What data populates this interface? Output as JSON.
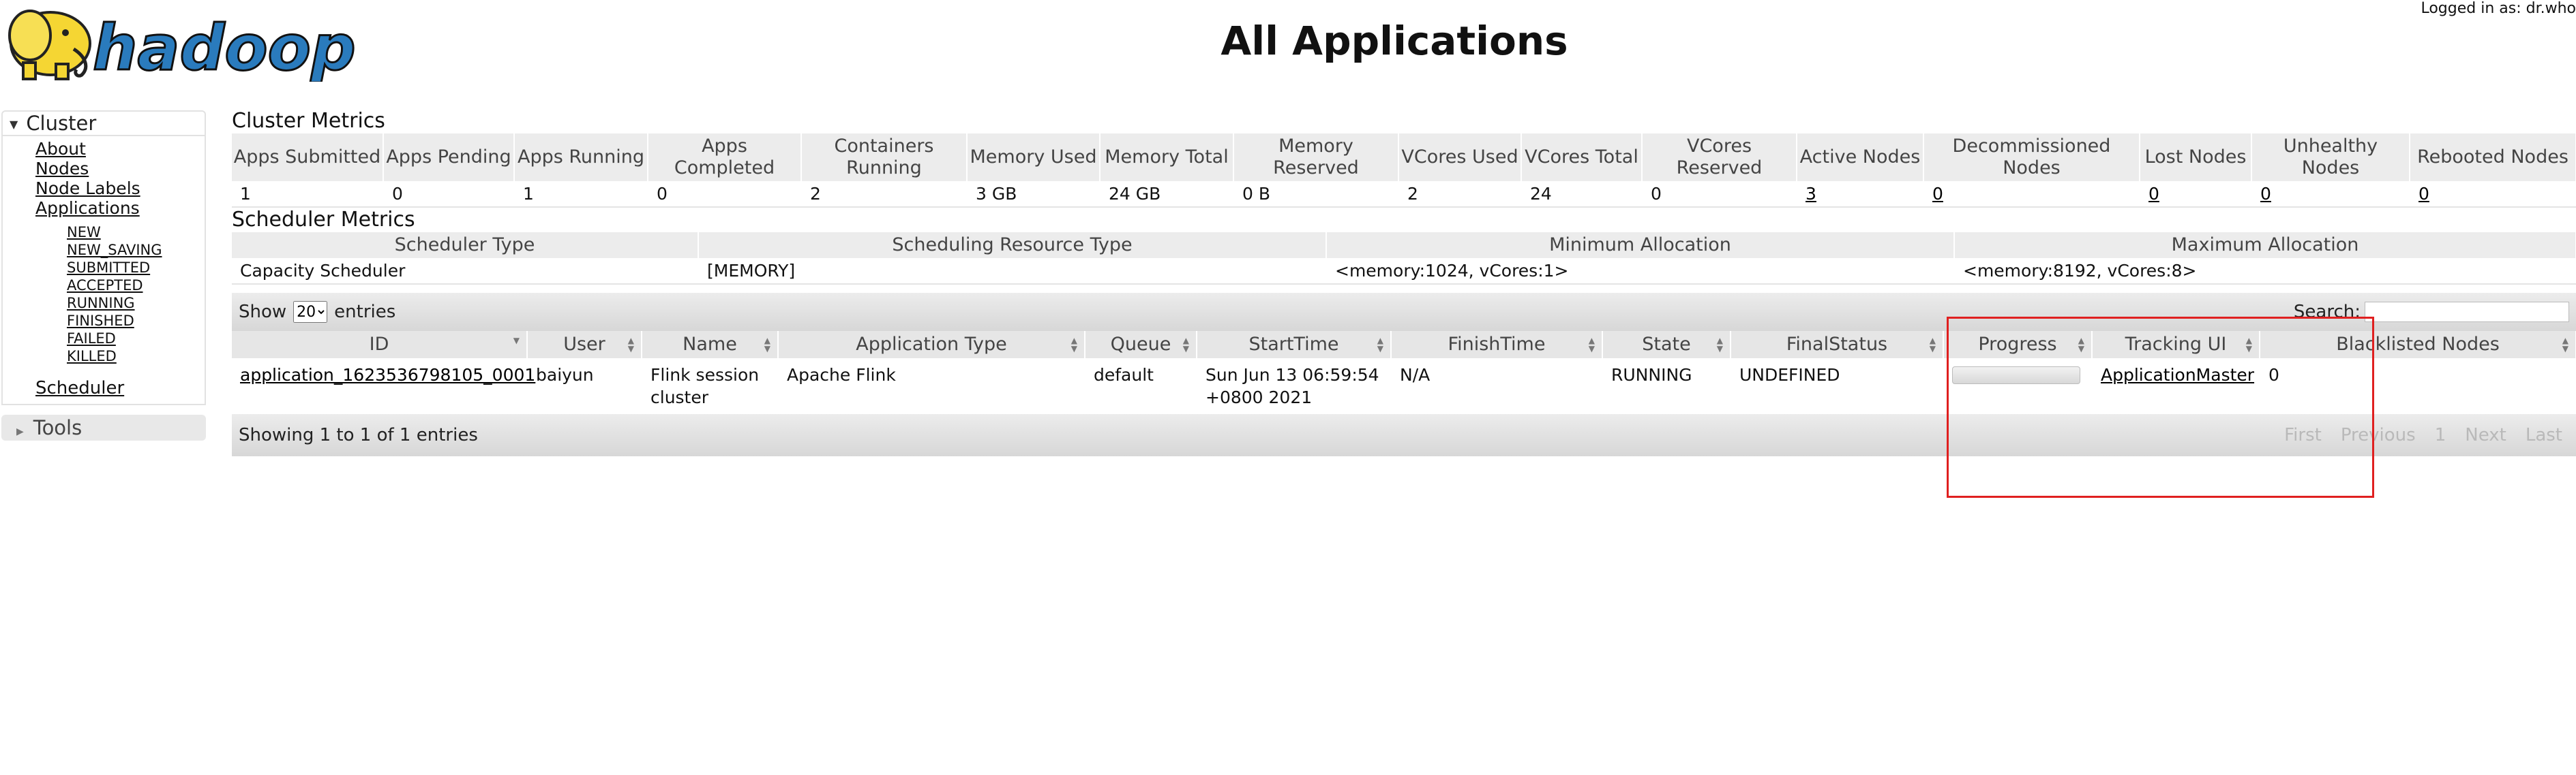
{
  "header": {
    "logo_text": "hadoop",
    "title": "All Applications",
    "logged_in": "Logged in as: dr.who"
  },
  "sidebar": {
    "cluster_label": "Cluster",
    "links": [
      "About",
      "Nodes",
      "Node Labels",
      "Applications"
    ],
    "app_states": [
      "NEW",
      "NEW_SAVING",
      "SUBMITTED",
      "ACCEPTED",
      "RUNNING",
      "FINISHED",
      "FAILED",
      "KILLED"
    ],
    "scheduler_label": "Scheduler",
    "tools_label": "Tools"
  },
  "cluster_metrics": {
    "title": "Cluster Metrics",
    "headers": [
      "Apps Submitted",
      "Apps Pending",
      "Apps Running",
      "Apps Completed",
      "Containers Running",
      "Memory Used",
      "Memory Total",
      "Memory Reserved",
      "VCores Used",
      "VCores Total",
      "VCores Reserved",
      "Active Nodes",
      "Decommissioned Nodes",
      "Lost Nodes",
      "Unhealthy Nodes",
      "Rebooted Nodes"
    ],
    "values": [
      "1",
      "0",
      "1",
      "0",
      "2",
      "3 GB",
      "24 GB",
      "0 B",
      "2",
      "24",
      "0",
      "3",
      "0",
      "0",
      "0",
      "0"
    ]
  },
  "scheduler_metrics": {
    "title": "Scheduler Metrics",
    "headers": [
      "Scheduler Type",
      "Scheduling Resource Type",
      "Minimum Allocation",
      "Maximum Allocation"
    ],
    "values": [
      "Capacity Scheduler",
      "[MEMORY]",
      "<memory:1024, vCores:1>",
      "<memory:8192, vCores:8>"
    ]
  },
  "apps_table": {
    "show_label": "Show",
    "entries_select": "20",
    "entries_label": "entries",
    "search_label": "Search:",
    "search_value": "",
    "columns": [
      "ID",
      "User",
      "Name",
      "Application Type",
      "Queue",
      "StartTime",
      "FinishTime",
      "State",
      "FinalStatus",
      "Progress",
      "Tracking UI",
      "Blacklisted Nodes"
    ],
    "rows": [
      {
        "id": "application_1623536798105_0001",
        "user": "baiyun",
        "name": "Flink session cluster",
        "type": "Apache Flink",
        "queue": "default",
        "start_time": "Sun Jun 13 06:59:54 +0800 2021",
        "finish_time": "N/A",
        "state": "RUNNING",
        "final_status": "UNDEFINED",
        "progress": 0,
        "tracking_ui": "ApplicationMaster",
        "blacklisted_nodes": "0"
      }
    ],
    "info": "Showing 1 to 1 of 1 entries",
    "pager": [
      "First",
      "Previous",
      "1",
      "Next",
      "Last"
    ]
  },
  "colors": {
    "highlight": "#e02020",
    "logo_blue": "#2a7bbd",
    "logo_yellow": "#f5d633"
  }
}
